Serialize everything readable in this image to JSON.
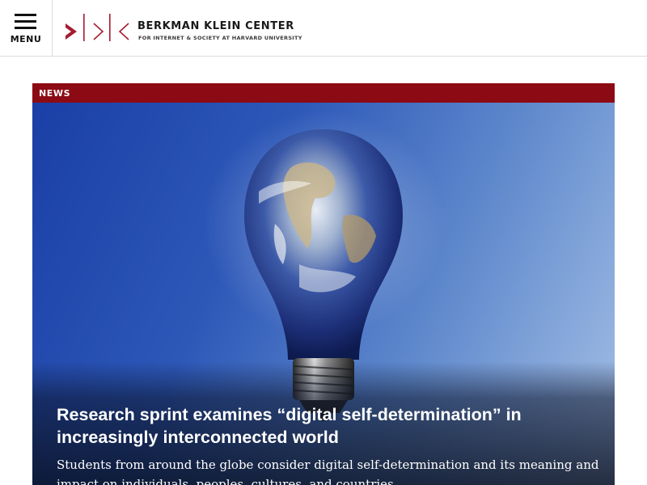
{
  "header": {
    "menu_label": "MENU",
    "logo": {
      "name": "BERKMAN KLEIN CENTER",
      "tagline": "FOR INTERNET & SOCIETY AT HARVARD UNIVERSITY",
      "mark_color": "#a51c30"
    }
  },
  "feature": {
    "tag": "NEWS",
    "tag_color": "#8c0a14",
    "image": "lightbulb-earth-image",
    "headline": "Research sprint examines “digital self-determination” in increasingly interconnected world",
    "summary": "Students from around the globe consider digital self-determination and its meaning and impact on individuals, peoples, cultures, and countries."
  }
}
